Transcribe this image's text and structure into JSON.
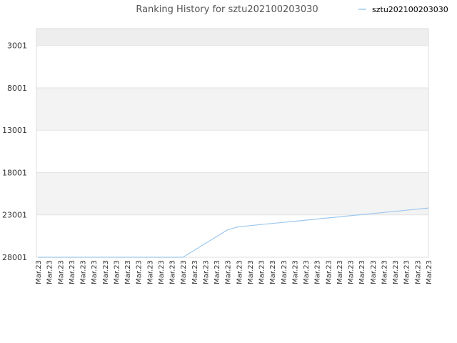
{
  "chart_data": {
    "type": "line",
    "title": "Ranking History for sztu202100203030",
    "xlabel": "",
    "ylabel": "",
    "y_inverted": true,
    "ylim": [
      1001,
      28001
    ],
    "yticks": [
      3001,
      8001,
      13001,
      18001,
      23001,
      28001
    ],
    "categories": [
      "Mar.23",
      "Mar.23",
      "Mar.23",
      "Mar.23",
      "Mar.23",
      "Mar.23",
      "Mar.23",
      "Mar.23",
      "Mar.23",
      "Mar.23",
      "Mar.23",
      "Mar.23",
      "Mar.23",
      "Mar.23",
      "Mar.23",
      "Mar.23",
      "Mar.23",
      "Mar.23",
      "Mar.23",
      "Mar.23",
      "Mar.23",
      "Mar.23",
      "Mar.23",
      "Mar.23",
      "Mar.23",
      "Mar.23",
      "Mar.23",
      "Mar.23",
      "Mar.23",
      "Mar.23",
      "Mar.23",
      "Mar.23",
      "Mar.23",
      "Mar.23",
      "Mar.23",
      "Mar.23"
    ],
    "series": [
      {
        "name": "sztu202100203030",
        "color": "#9ec8ee",
        "values": [
          28001,
          28001,
          28001,
          28001,
          28001,
          28001,
          28001,
          28001,
          28001,
          28001,
          28001,
          28001,
          28001,
          28001,
          27190,
          26380,
          25570,
          24760,
          24400,
          24270,
          24140,
          24010,
          23880,
          23750,
          23620,
          23490,
          23360,
          23230,
          23100,
          22970,
          22840,
          22710,
          22580,
          22450,
          22320,
          22190
        ]
      }
    ],
    "grid": true,
    "band_colors": [
      "#eeeeee",
      "#f3f3f3",
      "#ffffff"
    ],
    "legend_position": "top-right"
  }
}
